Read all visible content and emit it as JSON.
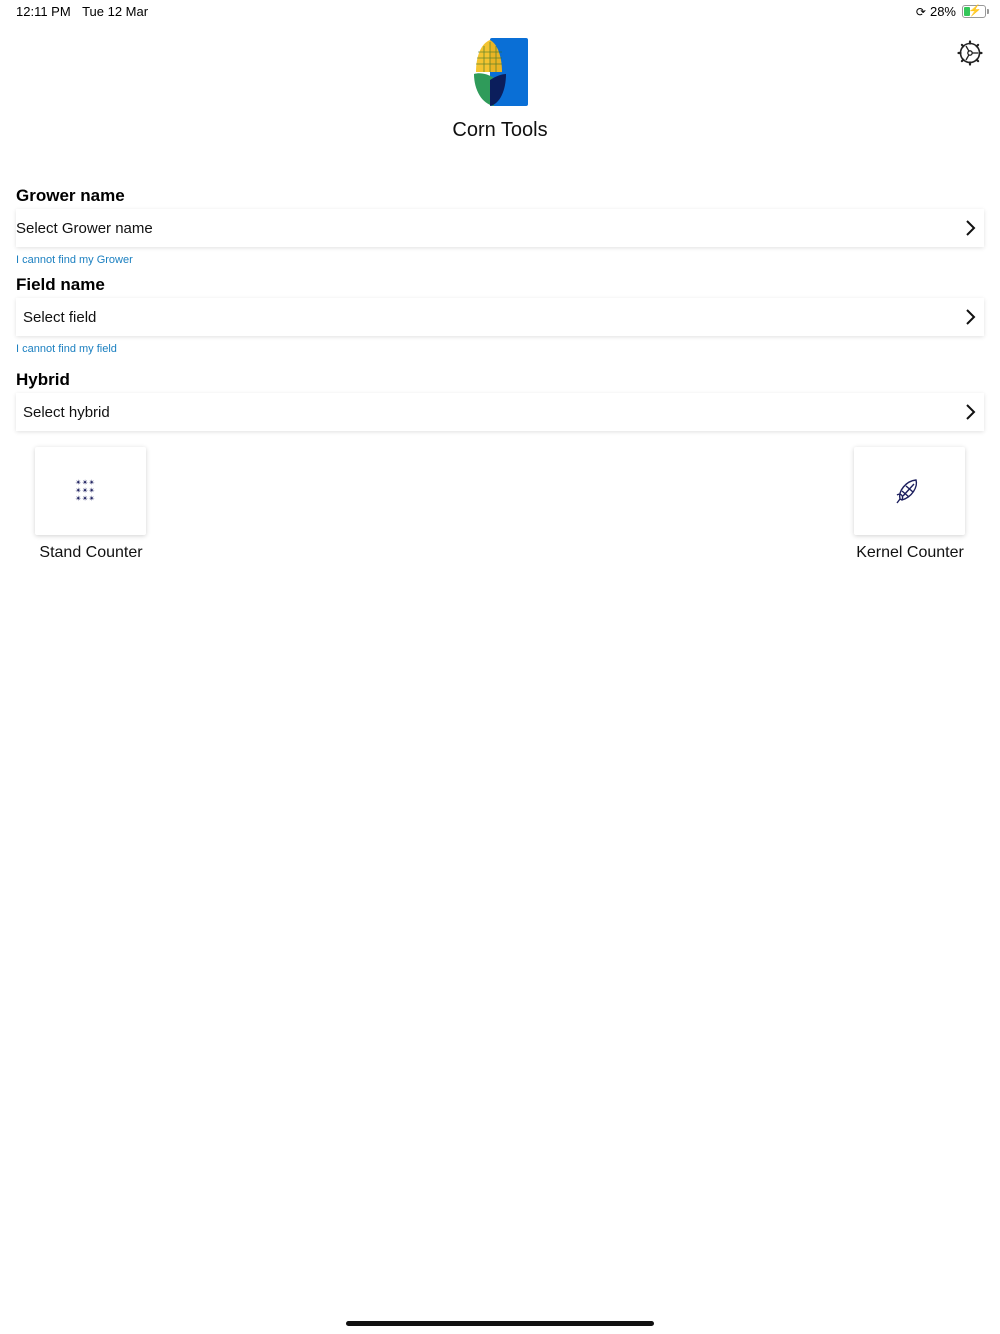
{
  "status_bar": {
    "time": "12:11 PM",
    "date": "Tue 12 Mar",
    "battery_percent": "28%",
    "battery_level": 0.28
  },
  "app": {
    "title": "Corn Tools",
    "logo_colors": {
      "blue": "#0a6fd6",
      "green": "#2f9b5a",
      "navy": "#0b1e5c",
      "yellow": "#f4c430"
    }
  },
  "form": {
    "grower": {
      "label": "Grower name",
      "placeholder": "Select Grower name",
      "help_link": "I cannot find my Grower"
    },
    "field": {
      "label": "Field name",
      "placeholder": "Select field",
      "help_link": "I cannot find my field"
    },
    "hybrid": {
      "label": "Hybrid",
      "placeholder": "Select hybrid"
    }
  },
  "tools": [
    {
      "label": "Stand Counter",
      "icon": "plant-grid-icon"
    },
    {
      "label": "Kernel Counter",
      "icon": "corn-cob-icon"
    }
  ],
  "colors": {
    "link": "#1a7fc0",
    "icon": "#1c1f5e"
  }
}
